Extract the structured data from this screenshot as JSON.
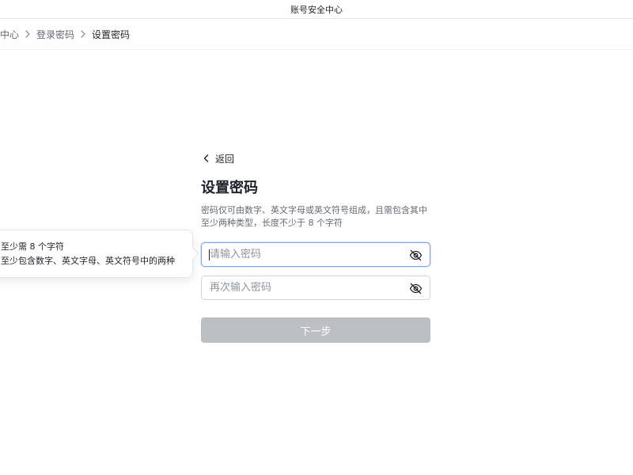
{
  "window": {
    "title": "账号安全中心"
  },
  "breadcrumb": {
    "items": [
      "中心",
      "登录密码",
      "设置密码"
    ]
  },
  "form": {
    "back_label": "返回",
    "title": "设置密码",
    "description": "密码仅可由数字、英文字母或英文符号组成，且需包含其中至少两种类型，长度不少于 8 个字符",
    "password_placeholder": "请输入密码",
    "password_value": "",
    "confirm_placeholder": "再次输入密码",
    "confirm_value": "",
    "next_label": "下一步",
    "next_enabled": false
  },
  "tooltip": {
    "rules": [
      "至少需 8 个字符",
      "至少包含数字、英文字母、英文符号中的两种"
    ]
  },
  "icons": {
    "back": "chevron-left-icon",
    "separator": "chevron-right-icon",
    "visibility": "eye-off-icon"
  },
  "colors": {
    "focus_border": "#7fa4ef",
    "disabled_button": "#bbbfc4",
    "text_primary": "#1f2329",
    "text_secondary": "#646a73",
    "placeholder": "#8f959e"
  }
}
